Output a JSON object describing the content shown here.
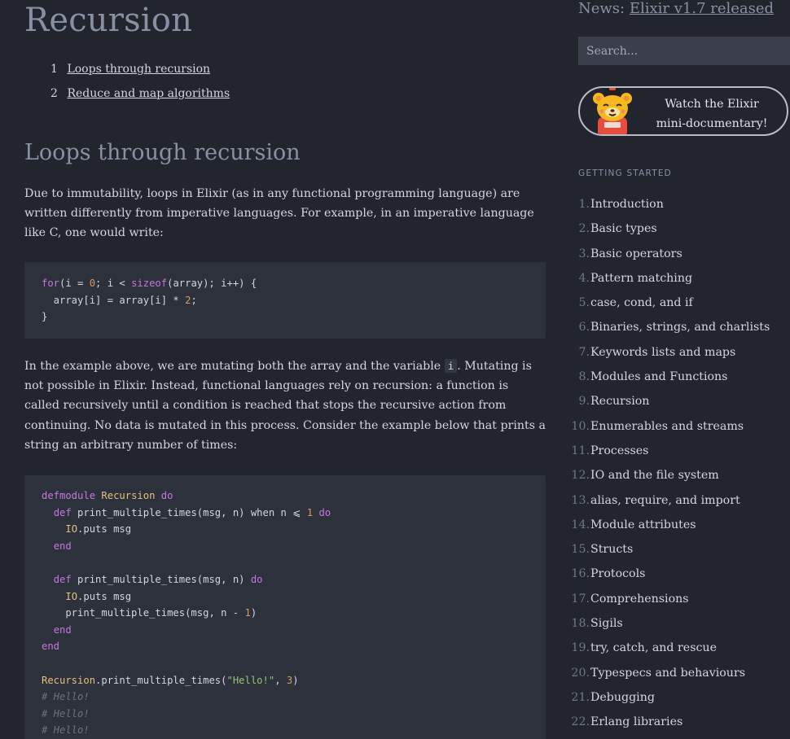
{
  "page": {
    "title": "Recursion"
  },
  "toc": [
    {
      "num": "1",
      "label": "Loops through recursion"
    },
    {
      "num": "2",
      "label": "Reduce and map algorithms"
    }
  ],
  "section": {
    "title": "Loops through recursion",
    "para1": "Due to immutability, loops in Elixir (as in any functional programming language) are written differently from imperative languages. For example, in an imperative language like C, one would write:",
    "para2_before": "In the example above, we are mutating both the array and the variable ",
    "para2_code": "i",
    "para2_after": ". Mutating is not possible in Elixir. Instead, functional languages rely on recursion: a function is called recursively until a condition is reached that stops the recursive action from continuing. No data is mutated in this process. Consider the example below that prints a string an arbitrary number of times:"
  },
  "code1": {
    "l1_kw": "for",
    "l1_a": "(i = ",
    "l1_n0": "0",
    "l1_b": "; i < ",
    "l1_fn": "sizeof",
    "l1_c": "(array); i++) {",
    "l2_a": "  array[i] = array[i] * ",
    "l2_n": "2",
    "l2_b": ";",
    "l3": "}"
  },
  "code2": {
    "l1_kw": "defmodule",
    "l1_mod": "Recursion",
    "l1_do": "do",
    "l2_def": "def",
    "l2_a": " print_multiple_times(msg, n) ",
    "l2_when": "when",
    "l2_b": " n ⩽ ",
    "l2_n": "1",
    "l2_do": "do",
    "l3_mod": "IO",
    "l3_a": ".puts msg",
    "l4_end": "end",
    "l6_def": "def",
    "l6_a": " print_multiple_times(msg, n) ",
    "l6_do": "do",
    "l7_mod": "IO",
    "l7_a": ".puts msg",
    "l8_a": "    print_multiple_times(msg, n - ",
    "l8_n": "1",
    "l8_b": ")",
    "l9_end": "end",
    "l10_end": "end",
    "l12_mod": "Recursion",
    "l12_a": ".print_multiple_times(",
    "l12_str": "\"Hello!\"",
    "l12_b": ", ",
    "l12_n": "3",
    "l12_c": ")",
    "c1": "# Hello!",
    "c2": "# Hello!",
    "c3": "# Hello!"
  },
  "sidebar": {
    "news_prefix": "News: ",
    "news_link": "Elixir v1.7 released",
    "search_placeholder": "Search...",
    "doc_line1": "Watch the Elixir",
    "doc_line2": "mini-documentary!",
    "nav_header": "GETTING STARTED",
    "nav": [
      {
        "n": "1.",
        "label": "Introduction"
      },
      {
        "n": "2.",
        "label": "Basic types"
      },
      {
        "n": "3.",
        "label": "Basic operators"
      },
      {
        "n": "4.",
        "label": "Pattern matching"
      },
      {
        "n": "5.",
        "label": "case, cond, and if"
      },
      {
        "n": "6.",
        "label": "Binaries, strings, and charlists"
      },
      {
        "n": "7.",
        "label": "Keywords lists and maps"
      },
      {
        "n": "8.",
        "label": "Modules and Functions"
      },
      {
        "n": "9.",
        "label": "Recursion"
      },
      {
        "n": "10.",
        "label": "Enumerables and streams"
      },
      {
        "n": "11.",
        "label": "Processes"
      },
      {
        "n": "12.",
        "label": "IO and the file system"
      },
      {
        "n": "13.",
        "label": "alias, require, and import"
      },
      {
        "n": "14.",
        "label": "Module attributes"
      },
      {
        "n": "15.",
        "label": "Structs"
      },
      {
        "n": "16.",
        "label": "Protocols"
      },
      {
        "n": "17.",
        "label": "Comprehensions"
      },
      {
        "n": "18.",
        "label": "Sigils"
      },
      {
        "n": "19.",
        "label": "try, catch, and rescue"
      },
      {
        "n": "20.",
        "label": "Typespecs and behaviours"
      },
      {
        "n": "21.",
        "label": "Debugging"
      },
      {
        "n": "22.",
        "label": "Erlang libraries"
      }
    ]
  },
  "colors": {
    "background": "#22252e",
    "code_bg": "#2d313c",
    "heading": "#8891a4",
    "keyword": "#c678dd",
    "module": "#e5c07b",
    "number": "#d19a66",
    "string": "#98c379"
  },
  "icons": {
    "doc_mascot": "bear-mascot-icon"
  }
}
